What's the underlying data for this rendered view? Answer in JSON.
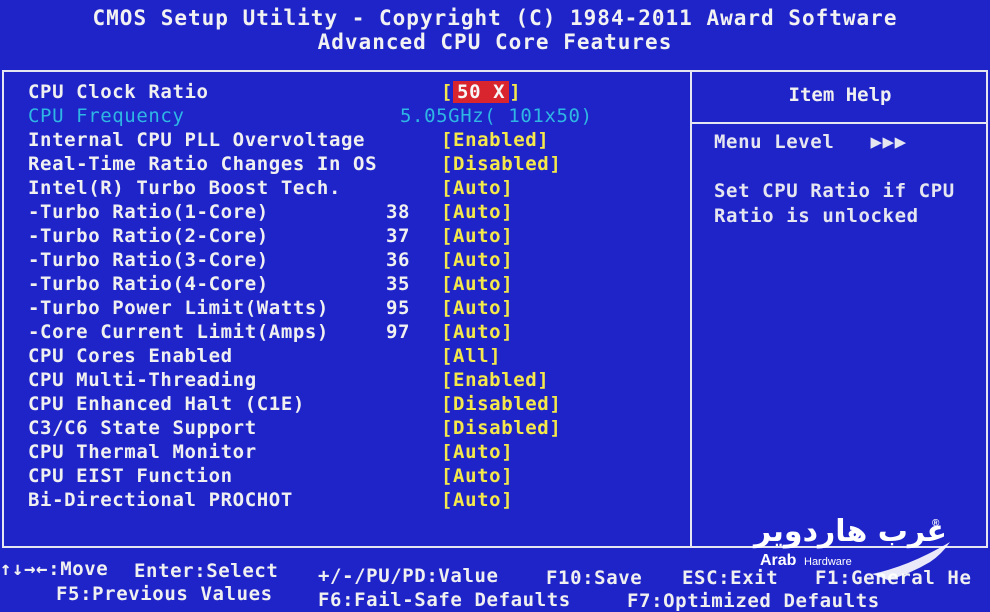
{
  "header": {
    "title": "CMOS Setup Utility - Copyright (C) 1984-2011 Award Software",
    "subtitle": "Advanced CPU Core Features"
  },
  "settings": [
    {
      "label": "CPU Clock Ratio",
      "number": "",
      "value": "[50 X]",
      "selected": true
    },
    {
      "label": "CPU Frequency",
      "number": "5.05GHz( 101x50)",
      "value": "",
      "dimmed": true
    },
    {
      "label": "Internal CPU PLL Overvoltage",
      "number": "",
      "value": "[Enabled]"
    },
    {
      "label": "Real-Time Ratio Changes In OS",
      "number": "",
      "value": "[Disabled]"
    },
    {
      "label": "Intel(R) Turbo Boost Tech.",
      "number": "",
      "value": "[Auto]"
    },
    {
      "label": "-Turbo Ratio(1-Core)",
      "number": "38",
      "value": "[Auto]"
    },
    {
      "label": "-Turbo Ratio(2-Core)",
      "number": "37",
      "value": "[Auto]"
    },
    {
      "label": "-Turbo Ratio(3-Core)",
      "number": "36",
      "value": "[Auto]"
    },
    {
      "label": "-Turbo Ratio(4-Core)",
      "number": "35",
      "value": "[Auto]"
    },
    {
      "label": "-Turbo Power Limit(Watts)",
      "number": "95",
      "value": "[Auto]"
    },
    {
      "label": "-Core Current Limit(Amps)",
      "number": "97",
      "value": "[Auto]"
    },
    {
      "label": "CPU Cores Enabled",
      "number": "",
      "value": "[All]"
    },
    {
      "label": "CPU Multi-Threading",
      "number": "",
      "value": "[Enabled]"
    },
    {
      "label": "CPU Enhanced Halt (C1E)",
      "number": "",
      "value": "[Disabled]"
    },
    {
      "label": "C3/C6 State Support",
      "number": "",
      "value": "[Disabled]"
    },
    {
      "label": "CPU Thermal Monitor",
      "number": "",
      "value": "[Auto]"
    },
    {
      "label": "CPU EIST Function",
      "number": "",
      "value": "[Auto]"
    },
    {
      "label": "Bi-Directional PROCHOT",
      "number": "",
      "value": "[Auto]"
    }
  ],
  "help": {
    "title": "Item Help",
    "menu_level": "Menu Level   ▶▶▶",
    "line1": "Set CPU Ratio if CPU",
    "line2": "Ratio is unlocked"
  },
  "footer": {
    "move": "↑↓→←:Move",
    "enter": "Enter:Select",
    "value": "+/-/PU/PD:Value",
    "f10": "F10:Save",
    "esc": "ESC:Exit",
    "f1": "F1:General He",
    "f5": "F5:Previous Values",
    "f6": "F6:Fail-Safe Defaults",
    "f7": "F7:Optimized Defaults"
  },
  "watermark": {
    "arabic": "عرب هاردوير",
    "english": "Arab",
    "english_small": "Hardware",
    "reg": "®"
  }
}
